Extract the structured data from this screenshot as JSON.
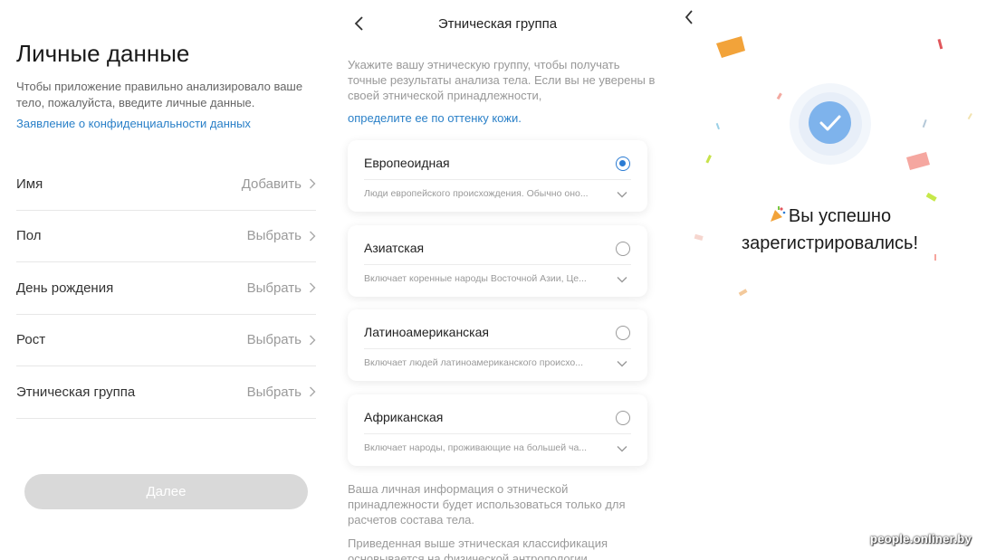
{
  "personal": {
    "title": "Личные данные",
    "description": "Чтобы приложение правильно анализировало ваше тело, пожалуйста, введите личные данные.",
    "privacy_link": "Заявление о конфиденциальности данных",
    "fields": [
      {
        "label": "Имя",
        "value": "Добавить"
      },
      {
        "label": "Пол",
        "value": "Выбрать"
      },
      {
        "label": "День рождения",
        "value": "Выбрать"
      },
      {
        "label": "Рост",
        "value": "Выбрать"
      },
      {
        "label": "Этническая группа",
        "value": "Выбрать"
      }
    ],
    "next_label": "Далее"
  },
  "ethnic": {
    "title": "Этническая группа",
    "hint": "Укажите вашу этническую группу, чтобы получать точные результаты анализа тела. Если вы не уверены в своей этнической принадлежности,",
    "hint_link": "определите ее по оттенку кожи.",
    "options": [
      {
        "name": "Европеоидная",
        "desc": "Люди европейского происхождения. Обычно оно...",
        "selected": true
      },
      {
        "name": "Азиатская",
        "desc": "Включает коренные народы Восточной Азии, Це...",
        "selected": false
      },
      {
        "name": "Латиноамериканская",
        "desc": "Включает людей латиноамериканского происхо...",
        "selected": false
      },
      {
        "name": "Африканская",
        "desc": "Включает народы, проживающие на большей ча...",
        "selected": false
      }
    ],
    "footer_1": "Ваша личная  информация о этнической принадлежности будет использоваться только для расчетов состава тела.",
    "footer_2": "Приведенная выше этническая классификация основывается на физической антропологии"
  },
  "success": {
    "message_line1": "Вы успешно",
    "message_line2": "зарегистрировались!",
    "icons": [
      "back-icon",
      "check-icon",
      "party-popper-icon"
    ],
    "accent": "#7eb3ec"
  },
  "watermark": "people.onliner.by",
  "colors": {
    "link": "#2a80c8",
    "radio_selected": "#2a7bd3",
    "button_disabled": "#d9d9d9"
  }
}
